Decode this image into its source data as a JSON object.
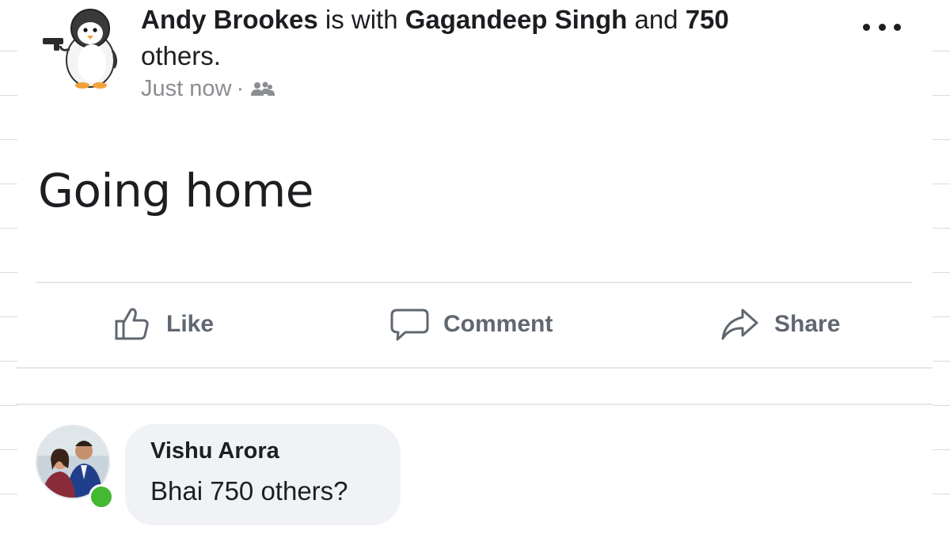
{
  "post": {
    "author": "Andy Brookes",
    "with_text": "is with",
    "tagged_friend": "Gagandeep Singh",
    "and_text": "and",
    "others_count": "750",
    "others_text": "others.",
    "timestamp": "Just now",
    "separator": "·",
    "audience_icon": "friends-icon",
    "more_icon": "more-options-icon",
    "body": "Going home"
  },
  "actions": {
    "like_label": "Like",
    "comment_label": "Comment",
    "share_label": "Share"
  },
  "comment": {
    "author": "Vishu Arora",
    "text": "Bhai 750 others?",
    "online_status_color": "#44b733"
  },
  "colors": {
    "text_primary": "#1c1e21",
    "text_secondary": "#8a8d91",
    "action_text": "#606770",
    "bubble_bg": "#f0f2f5"
  }
}
